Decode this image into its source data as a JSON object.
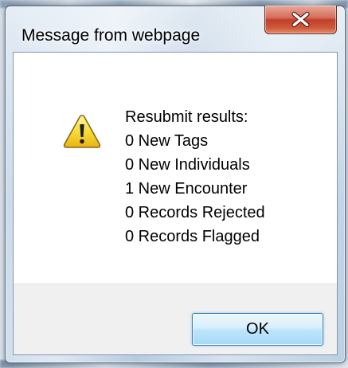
{
  "dialog": {
    "title": "Message from webpage",
    "icon": "warning-icon",
    "message_lines": [
      "Resubmit results:",
      "0 New Tags",
      "0 New Individuals",
      "1 New Encounter",
      "0 Records Rejected",
      "0 Records Flagged"
    ],
    "ok_label": "OK",
    "close_icon": "close-icon"
  },
  "colors": {
    "close_button": "#c7452f",
    "ok_button_border": "#3c7fb1",
    "warning_yellow": "#f6d52c"
  }
}
